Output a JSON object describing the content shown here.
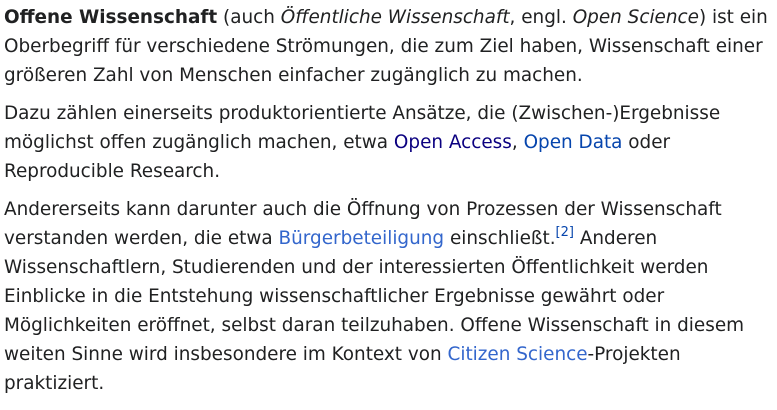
{
  "colors": {
    "text": "#202122",
    "link": "#3366cc",
    "link_dark": "#0b0080",
    "link_visited": "#0645ad"
  },
  "p1": {
    "bold_term": "Offene Wissenschaft",
    "t1": " (auch ",
    "alt_name": "Öffentliche Wissenschaft",
    "t2": ", engl. ",
    "english_name": "Open Science",
    "t3": ") ist ein Oberbegriff für verschiedene Strömungen, die zum Ziel haben, Wissenschaft einer größeren Zahl von Menschen einfacher zugänglich zu machen."
  },
  "p2": {
    "t1": "Dazu zählen einerseits produktorientierte Ansätze, die (Zwischen-)Ergebnisse möglichst offen zugänglich machen, etwa ",
    "link_open_access": "Open Access",
    "t2": ", ",
    "link_open_data": "Open Data",
    "t3": " oder Reproducible Research."
  },
  "p3": {
    "t1": "Andererseits kann darunter auch die Öffnung von Prozessen der Wissenschaft verstanden werden, die etwa ",
    "link_buergerbeteiligung": "Bürgerbeteiligung",
    "t2": " einschließt.",
    "ref": "[2]",
    "t3": " Anderen Wissenschaftlern, Studierenden und der interessierten Öffentlichkeit werden Einblicke in die Entstehung wissenschaftlicher Ergebnisse gewährt oder Möglichkeiten eröffnet, selbst daran teilzuhaben. Offene Wissenschaft in diesem weiten Sinne wird insbesondere im Kontext von ",
    "link_citizen_science": "Citizen Science",
    "t4": "-Projekten praktiziert."
  }
}
